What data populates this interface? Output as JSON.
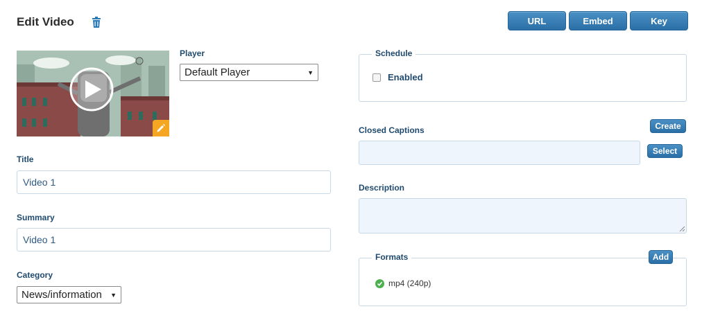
{
  "header": {
    "title": "Edit Video",
    "buttons": {
      "url": "URL",
      "embed": "Embed",
      "key": "Key"
    }
  },
  "player": {
    "label": "Player",
    "selected": "Default Player"
  },
  "title_field": {
    "label": "Title",
    "value": "Video 1"
  },
  "summary_field": {
    "label": "Summary",
    "value": "Video 1"
  },
  "category": {
    "label": "Category",
    "selected": "News/information"
  },
  "schedule": {
    "legend": "Schedule",
    "enabled_label": "Enabled",
    "enabled": false
  },
  "closed_captions": {
    "label": "Closed Captions",
    "value": "",
    "create_label": "Create",
    "select_label": "Select"
  },
  "description": {
    "label": "Description",
    "value": ""
  },
  "formats": {
    "legend": "Formats",
    "add_label": "Add",
    "items": [
      {
        "name": "mp4 (240p)",
        "status": "ok"
      }
    ]
  },
  "colors": {
    "accent": "#2a6fa6",
    "label": "#1f4a6e",
    "border": "#c7d7e6",
    "edit_badge": "#f5a623",
    "ok": "#4caf50"
  }
}
